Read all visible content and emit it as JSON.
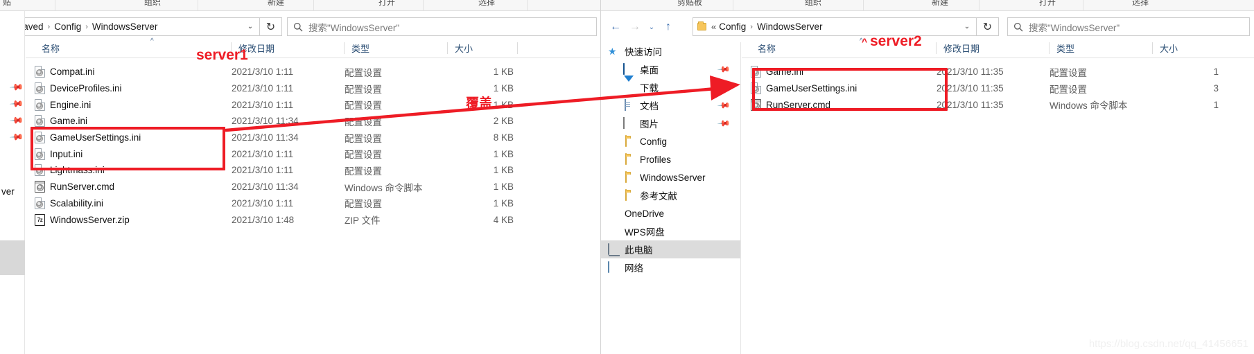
{
  "meta": {
    "watermark": "https://blog.csdn.net/qq_41456651"
  },
  "ribbon": {
    "left_groups": [
      "贴",
      "组织",
      "新建",
      "打开",
      "选择"
    ],
    "right_groups": [
      "剪贴板",
      "组织",
      "新建",
      "打开",
      "选择"
    ]
  },
  "left_window": {
    "nav": {
      "back": "‹",
      "dropdown": "⌄",
      "refresh": "↻"
    },
    "breadcrumb": {
      "prefix": "«",
      "items": [
        "Saved",
        "Config",
        "WindowsServer"
      ],
      "separator": "›"
    },
    "search": {
      "placeholder": "搜索\"WindowsServer\"",
      "icon": "search-icon"
    },
    "columns": [
      {
        "key": "name",
        "label": "名称"
      },
      {
        "key": "date",
        "label": "修改日期"
      },
      {
        "key": "type",
        "label": "类型"
      },
      {
        "key": "size",
        "label": "大小"
      }
    ],
    "sort_indicator": "^",
    "files": [
      {
        "name": "Compat.ini",
        "date": "2021/3/10 1:11",
        "type": "配置设置",
        "size": "1 KB",
        "icon": "ini-file-icon"
      },
      {
        "name": "DeviceProfiles.ini",
        "date": "2021/3/10 1:11",
        "type": "配置设置",
        "size": "1 KB",
        "icon": "ini-file-icon"
      },
      {
        "name": "Engine.ini",
        "date": "2021/3/10 1:11",
        "type": "配置设置",
        "size": "1 KB",
        "icon": "ini-file-icon"
      },
      {
        "name": "Game.ini",
        "date": "2021/3/10 11:34",
        "type": "配置设置",
        "size": "2 KB",
        "icon": "ini-file-icon"
      },
      {
        "name": "GameUserSettings.ini",
        "date": "2021/3/10 11:34",
        "type": "配置设置",
        "size": "8 KB",
        "icon": "ini-file-icon"
      },
      {
        "name": "Input.ini",
        "date": "2021/3/10 1:11",
        "type": "配置设置",
        "size": "1 KB",
        "icon": "ini-file-icon"
      },
      {
        "name": "Lightmass.ini",
        "date": "2021/3/10 1:11",
        "type": "配置设置",
        "size": "1 KB",
        "icon": "ini-file-icon"
      },
      {
        "name": "RunServer.cmd",
        "date": "2021/3/10 11:34",
        "type": "Windows 命令脚本",
        "size": "1 KB",
        "icon": "cmd-file-icon"
      },
      {
        "name": "Scalability.ini",
        "date": "2021/3/10 1:11",
        "type": "配置设置",
        "size": "1 KB",
        "icon": "ini-file-icon"
      },
      {
        "name": "WindowsServer.zip",
        "date": "2021/3/10 1:48",
        "type": "ZIP 文件",
        "size": "4 KB",
        "icon": "zip-file-icon"
      }
    ],
    "sidebar_stub": "ver"
  },
  "right_window": {
    "nav": {
      "back": "←",
      "forward": "→",
      "recent": "⌄",
      "up": "↑",
      "refresh": "↻"
    },
    "breadcrumb": {
      "prefix": "«",
      "items": [
        "Config",
        "WindowsServer"
      ],
      "separator": "›"
    },
    "search": {
      "placeholder": "搜索\"WindowsServer\"",
      "icon": "search-icon"
    },
    "columns": [
      {
        "key": "name",
        "label": "名称"
      },
      {
        "key": "date",
        "label": "修改日期"
      },
      {
        "key": "type",
        "label": "类型"
      },
      {
        "key": "size",
        "label": "大小"
      }
    ],
    "sort_indicator": "^",
    "nav_tree": [
      {
        "label": "快速访问",
        "icon": "star-icon",
        "indent": 0,
        "pinned": false,
        "selected": false
      },
      {
        "label": "桌面",
        "icon": "desktop-icon",
        "indent": 1,
        "pinned": true,
        "selected": false
      },
      {
        "label": "下载",
        "icon": "download-icon",
        "indent": 1,
        "pinned": true,
        "selected": false
      },
      {
        "label": "文档",
        "icon": "document-icon",
        "indent": 1,
        "pinned": true,
        "selected": false
      },
      {
        "label": "图片",
        "icon": "pictures-icon",
        "indent": 1,
        "pinned": true,
        "selected": false
      },
      {
        "label": "Config",
        "icon": "folder-icon",
        "indent": 1,
        "pinned": false,
        "selected": false
      },
      {
        "label": "Profiles",
        "icon": "folder-icon",
        "indent": 1,
        "pinned": false,
        "selected": false
      },
      {
        "label": "WindowsServer",
        "icon": "folder-icon",
        "indent": 1,
        "pinned": false,
        "selected": false
      },
      {
        "label": "参考文献",
        "icon": "folder-icon",
        "indent": 1,
        "pinned": false,
        "selected": false
      },
      {
        "label": "OneDrive",
        "icon": "onedrive-icon",
        "indent": 0,
        "pinned": false,
        "selected": false
      },
      {
        "label": "WPS网盘",
        "icon": "wps-cloud-icon",
        "indent": 0,
        "pinned": false,
        "selected": false
      },
      {
        "label": "此电脑",
        "icon": "this-pc-icon",
        "indent": 0,
        "pinned": false,
        "selected": true
      },
      {
        "label": "网络",
        "icon": "network-icon",
        "indent": 0,
        "pinned": false,
        "selected": false
      }
    ],
    "files": [
      {
        "name": "Game.ini",
        "date": "2021/3/10 11:35",
        "type": "配置设置",
        "size": "1",
        "icon": "ini-file-icon"
      },
      {
        "name": "GameUserSettings.ini",
        "date": "2021/3/10 11:35",
        "type": "配置设置",
        "size": "3",
        "icon": "ini-file-icon"
      },
      {
        "name": "RunServer.cmd",
        "date": "2021/3/10 11:35",
        "type": "Windows 命令脚本",
        "size": "1",
        "icon": "cmd-file-icon"
      }
    ]
  },
  "annotations": {
    "accent_color": "#ee1c25",
    "label_server1": "server1",
    "label_server2": "server2",
    "label_overwrite": "覆盖",
    "caret_server2": "^"
  }
}
